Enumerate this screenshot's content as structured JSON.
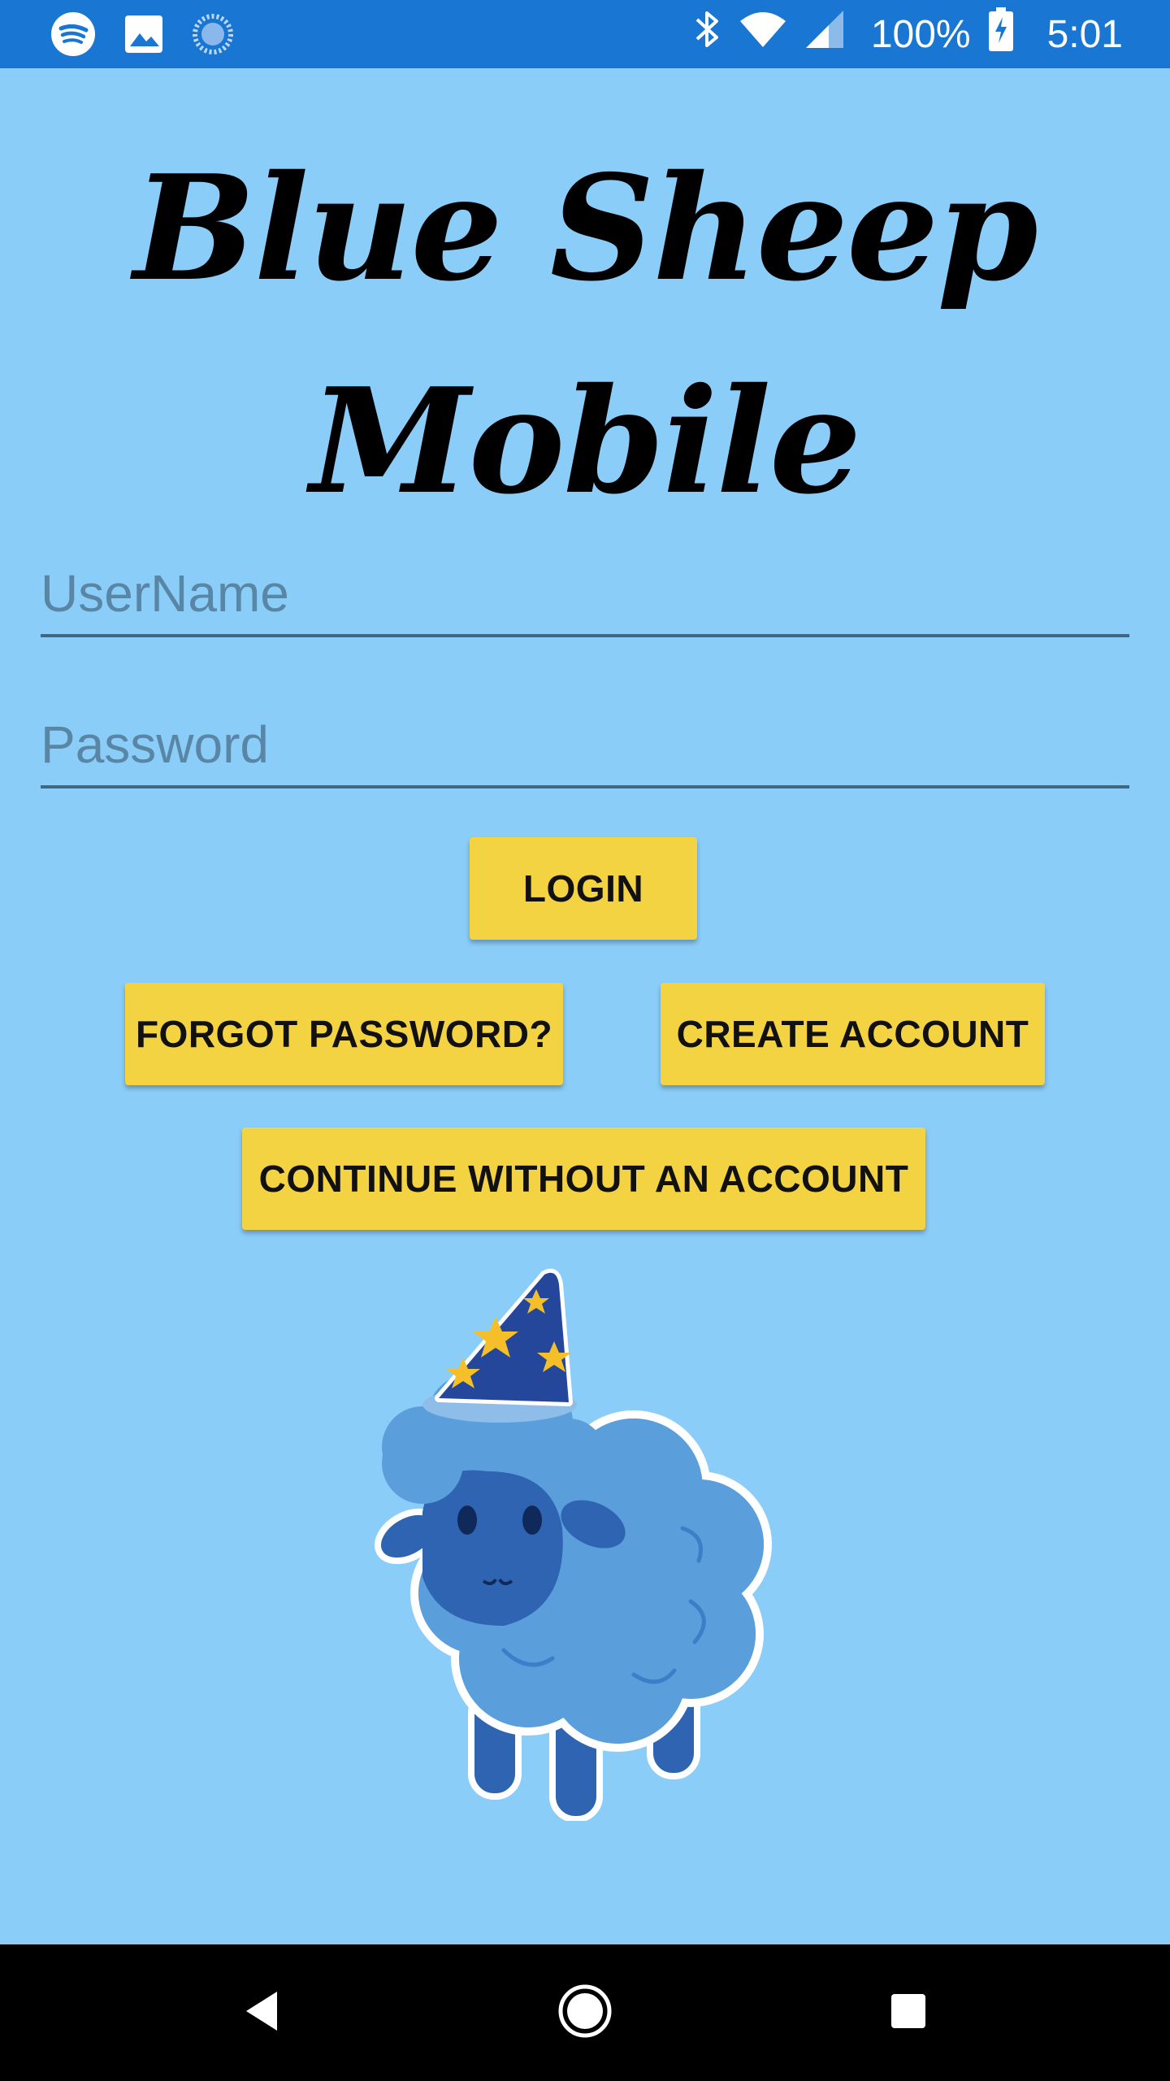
{
  "status_bar": {
    "battery_percent": "100%",
    "time": "5:01",
    "left_icons": [
      "spotify-icon",
      "image-icon",
      "sync-icon"
    ],
    "right_icons": [
      "bluetooth-icon",
      "wifi-icon",
      "signal-icon",
      "battery-charging-icon"
    ]
  },
  "app": {
    "title_line1": "Blue Sheep",
    "title_line2": "Mobile"
  },
  "form": {
    "username_placeholder": "UserName",
    "password_placeholder": "Password"
  },
  "buttons": {
    "login": "LOGIN",
    "forgot_password": "FORGOT PASSWORD?",
    "create_account": "CREATE ACCOUNT",
    "continue_without_account": "CONTINUE WITHOUT AN ACCOUNT"
  },
  "colors": {
    "background": "#8bcdf9",
    "status_bar": "#1976d2",
    "button": "#f4d343",
    "nav_bar": "#000000"
  },
  "nav_bar": {
    "icons": [
      "back-icon",
      "home-icon",
      "recents-icon"
    ]
  }
}
